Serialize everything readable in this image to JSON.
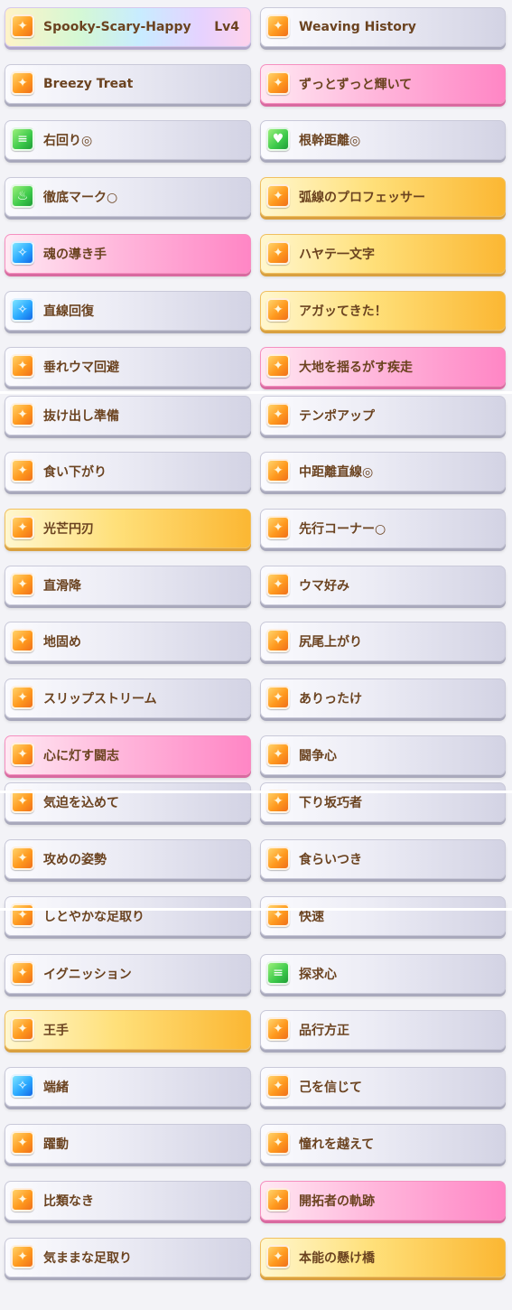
{
  "skills": [
    {
      "name": "Spooky-Scary-Happy",
      "level": "Lv4",
      "rarity": "rainbow",
      "icon": "speed-icon"
    },
    {
      "name": "Weaving History",
      "rarity": "normal",
      "icon": "speed-icon"
    },
    {
      "name": "Breezy Treat",
      "rarity": "normal",
      "icon": "speed-icon"
    },
    {
      "name": "ずっとずっと輝いて",
      "rarity": "pink",
      "icon": "speed-icon"
    },
    {
      "name": "右回り◎",
      "rarity": "normal",
      "icon": "course-icon"
    },
    {
      "name": "根幹距離◎",
      "rarity": "normal",
      "icon": "stamina-icon"
    },
    {
      "name": "徹底マーク○",
      "rarity": "normal",
      "icon": "debuff-icon"
    },
    {
      "name": "弧線のプロフェッサー",
      "rarity": "gold",
      "icon": "speed-icon"
    },
    {
      "name": "魂の導き手",
      "rarity": "pink",
      "icon": "recovery-icon"
    },
    {
      "name": "ハヤテ一文字",
      "rarity": "gold",
      "icon": "speed-icon"
    },
    {
      "name": "直線回復",
      "rarity": "normal",
      "icon": "recovery-icon"
    },
    {
      "name": "アガッてきた！",
      "rarity": "gold",
      "icon": "speed-icon"
    },
    {
      "name": "垂れウマ回避",
      "rarity": "normal",
      "icon": "speed-icon"
    },
    {
      "name": "大地を揺るがす疾走",
      "rarity": "pink",
      "icon": "speed-icon"
    },
    {
      "name": "抜け出し準備",
      "rarity": "normal",
      "icon": "speed-icon"
    },
    {
      "name": "テンポアップ",
      "rarity": "normal",
      "icon": "speed-icon"
    },
    {
      "name": "食い下がり",
      "rarity": "normal",
      "icon": "speed-icon"
    },
    {
      "name": "中距離直線◎",
      "rarity": "normal",
      "icon": "speed-icon"
    },
    {
      "name": "光芒円刃",
      "rarity": "gold",
      "icon": "speed-icon"
    },
    {
      "name": "先行コーナー○",
      "rarity": "normal",
      "icon": "speed-icon"
    },
    {
      "name": "直滑降",
      "rarity": "normal",
      "icon": "speed-icon"
    },
    {
      "name": "ウマ好み",
      "rarity": "normal",
      "icon": "speed-icon"
    },
    {
      "name": "地固め",
      "rarity": "normal",
      "icon": "speed-icon"
    },
    {
      "name": "尻尾上がり",
      "rarity": "normal",
      "icon": "speed-icon"
    },
    {
      "name": "スリップストリーム",
      "rarity": "normal",
      "icon": "speed-icon"
    },
    {
      "name": "ありったけ",
      "rarity": "normal",
      "icon": "speed-icon"
    },
    {
      "name": "心に灯す闘志",
      "rarity": "pink",
      "icon": "speed-icon"
    },
    {
      "name": "闘争心",
      "rarity": "normal",
      "icon": "speed-icon"
    },
    {
      "name": "気迫を込めて",
      "rarity": "normal",
      "icon": "speed-icon"
    },
    {
      "name": "下り坂巧者",
      "rarity": "normal",
      "icon": "speed-icon"
    },
    {
      "name": "攻めの姿勢",
      "rarity": "normal",
      "icon": "speed-icon"
    },
    {
      "name": "食らいつき",
      "rarity": "normal",
      "icon": "speed-icon"
    },
    {
      "name": "しとやかな足取り",
      "rarity": "normal",
      "icon": "speed-icon"
    },
    {
      "name": "快速",
      "rarity": "normal",
      "icon": "speed-icon"
    },
    {
      "name": "イグニッション",
      "rarity": "normal",
      "icon": "speed-icon"
    },
    {
      "name": "探求心",
      "rarity": "normal",
      "icon": "course-icon"
    },
    {
      "name": "王手",
      "rarity": "gold",
      "icon": "speed-icon"
    },
    {
      "name": "品行方正",
      "rarity": "normal",
      "icon": "speed-icon"
    },
    {
      "name": "端緒",
      "rarity": "normal",
      "icon": "recovery-icon"
    },
    {
      "name": "己を信じて",
      "rarity": "normal",
      "icon": "speed-icon"
    },
    {
      "name": "躍動",
      "rarity": "normal",
      "icon": "speed-icon"
    },
    {
      "name": "憧れを越えて",
      "rarity": "normal",
      "icon": "speed-icon"
    },
    {
      "name": "比類なき",
      "rarity": "normal",
      "icon": "speed-icon"
    },
    {
      "name": "開拓者の軌跡",
      "rarity": "pink",
      "icon": "speed-icon"
    },
    {
      "name": "気ままな足取り",
      "rarity": "normal",
      "icon": "speed-icon"
    },
    {
      "name": "本能の懸け橋",
      "rarity": "gold",
      "icon": "speed-icon"
    }
  ]
}
